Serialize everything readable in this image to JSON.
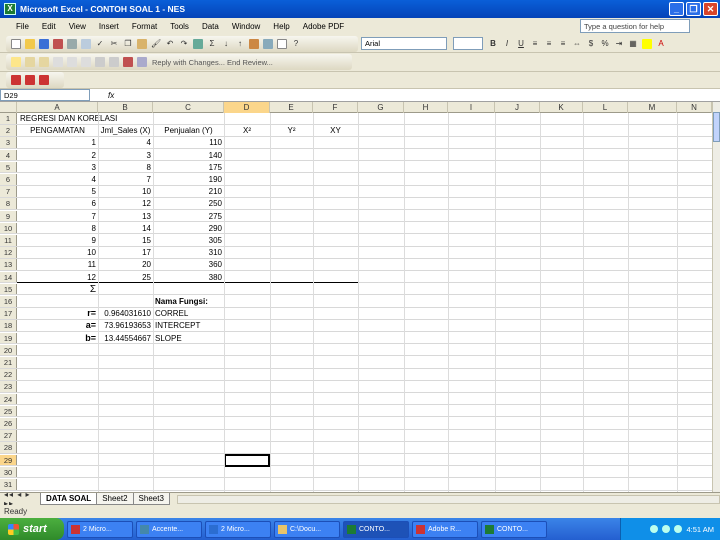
{
  "window": {
    "title": "Microsoft Excel - CONTOH SOAL 1 - NES"
  },
  "menu": [
    "File",
    "Edit",
    "View",
    "Insert",
    "Format",
    "Tools",
    "Data",
    "Window",
    "Help",
    "Adobe PDF"
  ],
  "help_box": {
    "placeholder": "Type a question for help"
  },
  "toolbar": {
    "font_name": "Arial",
    "reply_text": "Reply with Changes... End Review..."
  },
  "formula_bar": {
    "name_box": "D29",
    "fx": "fx",
    "content": ""
  },
  "columns": [
    {
      "label": "A",
      "w": 0
    },
    {
      "label": "B"
    },
    {
      "label": "C"
    },
    {
      "label": "D"
    },
    {
      "label": "E"
    },
    {
      "label": "F"
    },
    {
      "label": "G"
    },
    {
      "label": "H"
    },
    {
      "label": "I"
    },
    {
      "label": "J"
    },
    {
      "label": "K"
    },
    {
      "label": "L"
    },
    {
      "label": "M"
    },
    {
      "label": "N"
    }
  ],
  "rows": {
    "1": {
      "A": "REGRESI DAN KORELASI"
    },
    "2": {
      "A": "PENGAMATAN",
      "B": "Jml_Sales (X)",
      "C": "Penjualan (Y)",
      "D": "X²",
      "E": "Y²",
      "F": "XY"
    },
    "3": {
      "A": "1",
      "B": "4",
      "C": "110"
    },
    "4": {
      "A": "2",
      "B": "3",
      "C": "140"
    },
    "5": {
      "A": "3",
      "B": "8",
      "C": "175"
    },
    "6": {
      "A": "4",
      "B": "7",
      "C": "190"
    },
    "7": {
      "A": "5",
      "B": "10",
      "C": "210"
    },
    "8": {
      "A": "6",
      "B": "12",
      "C": "250"
    },
    "9": {
      "A": "7",
      "B": "13",
      "C": "275"
    },
    "10": {
      "A": "8",
      "B": "14",
      "C": "290"
    },
    "11": {
      "A": "9",
      "B": "15",
      "C": "305"
    },
    "12": {
      "A": "10",
      "B": "17",
      "C": "310"
    },
    "13": {
      "A": "11",
      "B": "20",
      "C": "360"
    },
    "14": {
      "A": "12",
      "B": "25",
      "C": "380"
    },
    "15": {
      "A": "Σ"
    },
    "16": {
      "C": "Nama Fungsi:"
    },
    "17": {
      "A": "r=",
      "B": "0.964031610",
      "C": "CORREL"
    },
    "18": {
      "A": "a=",
      "B": "73.96193653",
      "C": "INTERCEPT"
    },
    "19": {
      "A": "b=",
      "B": "13.44554667",
      "C": "SLOPE"
    }
  },
  "row_count": 31,
  "selected": {
    "col": "D",
    "row": 29
  },
  "sheets": [
    {
      "label": "DATA SOAL",
      "active": true
    },
    {
      "label": "Sheet2",
      "active": false
    },
    {
      "label": "Sheet3",
      "active": false
    }
  ],
  "status": "Ready",
  "taskbar": {
    "start": "start",
    "tasks": [
      "2 Micro...",
      "Accente...",
      "2 Micro...",
      "C:\\Docu...",
      "CONTO...",
      "Adobe R...",
      "CONTO..."
    ],
    "active_task": 4,
    "clock": "4:51 AM"
  }
}
